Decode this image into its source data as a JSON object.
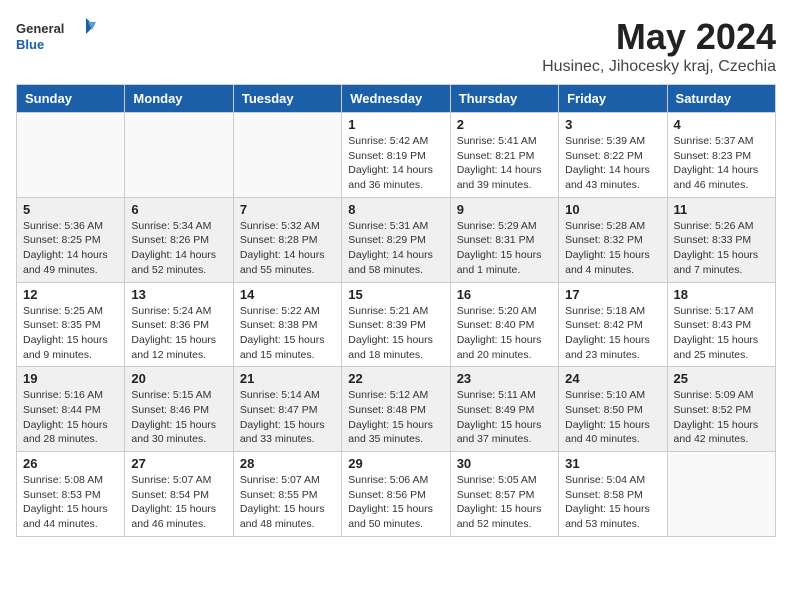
{
  "header": {
    "logo_general": "General",
    "logo_blue": "Blue",
    "title": "May 2024",
    "location": "Husinec, Jihocesky kraj, Czechia"
  },
  "days_of_week": [
    "Sunday",
    "Monday",
    "Tuesday",
    "Wednesday",
    "Thursday",
    "Friday",
    "Saturday"
  ],
  "weeks": [
    {
      "alt": false,
      "days": [
        {
          "number": "",
          "info": ""
        },
        {
          "number": "",
          "info": ""
        },
        {
          "number": "",
          "info": ""
        },
        {
          "number": "1",
          "info": "Sunrise: 5:42 AM\nSunset: 8:19 PM\nDaylight: 14 hours\nand 36 minutes."
        },
        {
          "number": "2",
          "info": "Sunrise: 5:41 AM\nSunset: 8:21 PM\nDaylight: 14 hours\nand 39 minutes."
        },
        {
          "number": "3",
          "info": "Sunrise: 5:39 AM\nSunset: 8:22 PM\nDaylight: 14 hours\nand 43 minutes."
        },
        {
          "number": "4",
          "info": "Sunrise: 5:37 AM\nSunset: 8:23 PM\nDaylight: 14 hours\nand 46 minutes."
        }
      ]
    },
    {
      "alt": true,
      "days": [
        {
          "number": "5",
          "info": "Sunrise: 5:36 AM\nSunset: 8:25 PM\nDaylight: 14 hours\nand 49 minutes."
        },
        {
          "number": "6",
          "info": "Sunrise: 5:34 AM\nSunset: 8:26 PM\nDaylight: 14 hours\nand 52 minutes."
        },
        {
          "number": "7",
          "info": "Sunrise: 5:32 AM\nSunset: 8:28 PM\nDaylight: 14 hours\nand 55 minutes."
        },
        {
          "number": "8",
          "info": "Sunrise: 5:31 AM\nSunset: 8:29 PM\nDaylight: 14 hours\nand 58 minutes."
        },
        {
          "number": "9",
          "info": "Sunrise: 5:29 AM\nSunset: 8:31 PM\nDaylight: 15 hours\nand 1 minute."
        },
        {
          "number": "10",
          "info": "Sunrise: 5:28 AM\nSunset: 8:32 PM\nDaylight: 15 hours\nand 4 minutes."
        },
        {
          "number": "11",
          "info": "Sunrise: 5:26 AM\nSunset: 8:33 PM\nDaylight: 15 hours\nand 7 minutes."
        }
      ]
    },
    {
      "alt": false,
      "days": [
        {
          "number": "12",
          "info": "Sunrise: 5:25 AM\nSunset: 8:35 PM\nDaylight: 15 hours\nand 9 minutes."
        },
        {
          "number": "13",
          "info": "Sunrise: 5:24 AM\nSunset: 8:36 PM\nDaylight: 15 hours\nand 12 minutes."
        },
        {
          "number": "14",
          "info": "Sunrise: 5:22 AM\nSunset: 8:38 PM\nDaylight: 15 hours\nand 15 minutes."
        },
        {
          "number": "15",
          "info": "Sunrise: 5:21 AM\nSunset: 8:39 PM\nDaylight: 15 hours\nand 18 minutes."
        },
        {
          "number": "16",
          "info": "Sunrise: 5:20 AM\nSunset: 8:40 PM\nDaylight: 15 hours\nand 20 minutes."
        },
        {
          "number": "17",
          "info": "Sunrise: 5:18 AM\nSunset: 8:42 PM\nDaylight: 15 hours\nand 23 minutes."
        },
        {
          "number": "18",
          "info": "Sunrise: 5:17 AM\nSunset: 8:43 PM\nDaylight: 15 hours\nand 25 minutes."
        }
      ]
    },
    {
      "alt": true,
      "days": [
        {
          "number": "19",
          "info": "Sunrise: 5:16 AM\nSunset: 8:44 PM\nDaylight: 15 hours\nand 28 minutes."
        },
        {
          "number": "20",
          "info": "Sunrise: 5:15 AM\nSunset: 8:46 PM\nDaylight: 15 hours\nand 30 minutes."
        },
        {
          "number": "21",
          "info": "Sunrise: 5:14 AM\nSunset: 8:47 PM\nDaylight: 15 hours\nand 33 minutes."
        },
        {
          "number": "22",
          "info": "Sunrise: 5:12 AM\nSunset: 8:48 PM\nDaylight: 15 hours\nand 35 minutes."
        },
        {
          "number": "23",
          "info": "Sunrise: 5:11 AM\nSunset: 8:49 PM\nDaylight: 15 hours\nand 37 minutes."
        },
        {
          "number": "24",
          "info": "Sunrise: 5:10 AM\nSunset: 8:50 PM\nDaylight: 15 hours\nand 40 minutes."
        },
        {
          "number": "25",
          "info": "Sunrise: 5:09 AM\nSunset: 8:52 PM\nDaylight: 15 hours\nand 42 minutes."
        }
      ]
    },
    {
      "alt": false,
      "days": [
        {
          "number": "26",
          "info": "Sunrise: 5:08 AM\nSunset: 8:53 PM\nDaylight: 15 hours\nand 44 minutes."
        },
        {
          "number": "27",
          "info": "Sunrise: 5:07 AM\nSunset: 8:54 PM\nDaylight: 15 hours\nand 46 minutes."
        },
        {
          "number": "28",
          "info": "Sunrise: 5:07 AM\nSunset: 8:55 PM\nDaylight: 15 hours\nand 48 minutes."
        },
        {
          "number": "29",
          "info": "Sunrise: 5:06 AM\nSunset: 8:56 PM\nDaylight: 15 hours\nand 50 minutes."
        },
        {
          "number": "30",
          "info": "Sunrise: 5:05 AM\nSunset: 8:57 PM\nDaylight: 15 hours\nand 52 minutes."
        },
        {
          "number": "31",
          "info": "Sunrise: 5:04 AM\nSunset: 8:58 PM\nDaylight: 15 hours\nand 53 minutes."
        },
        {
          "number": "",
          "info": ""
        }
      ]
    }
  ]
}
